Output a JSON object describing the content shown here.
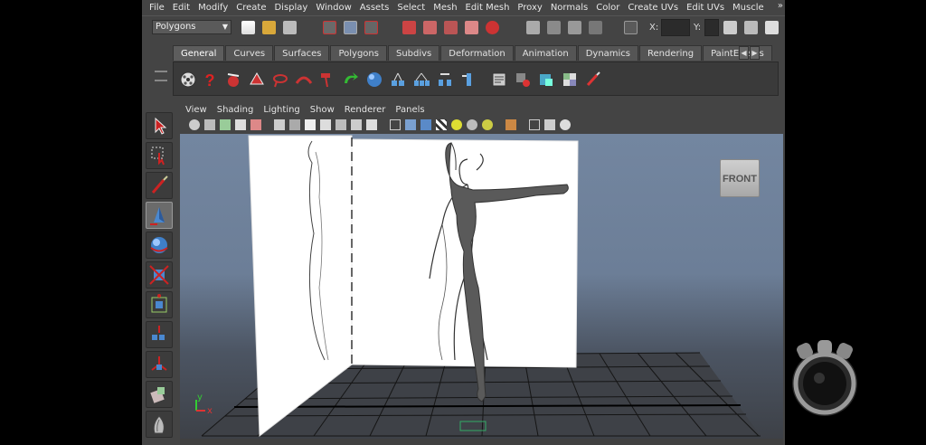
{
  "menubar": {
    "items": [
      "File",
      "Edit",
      "Modify",
      "Create",
      "Display",
      "Window",
      "Assets",
      "Select",
      "Mesh",
      "Edit Mesh",
      "Proxy",
      "Normals",
      "Color",
      "Create UVs",
      "Edit UVs",
      "Muscle"
    ],
    "overflow": "»"
  },
  "statusline": {
    "mode": "Polygons",
    "x_label": "X:",
    "y_label": "Y:"
  },
  "shelf": {
    "tabs": [
      "General",
      "Curves",
      "Surfaces",
      "Polygons",
      "Subdivs",
      "Deformation",
      "Animation",
      "Dynamics",
      "Rendering",
      "PaintEffects"
    ],
    "active_tab": "General"
  },
  "panel": {
    "menu": [
      "View",
      "Shading",
      "Lighting",
      "Show",
      "Renderer",
      "Panels"
    ]
  },
  "viewport": {
    "viewcube_label": "FRONT",
    "axis_y": "y",
    "axis_x": "x"
  },
  "colors": {
    "ui_bg": "#444444",
    "viewport_top": "#7386a0",
    "viewport_bottom": "#3c3f45",
    "grid": "#1a1a1a",
    "plane": "#ffffff",
    "model": "#555555"
  }
}
